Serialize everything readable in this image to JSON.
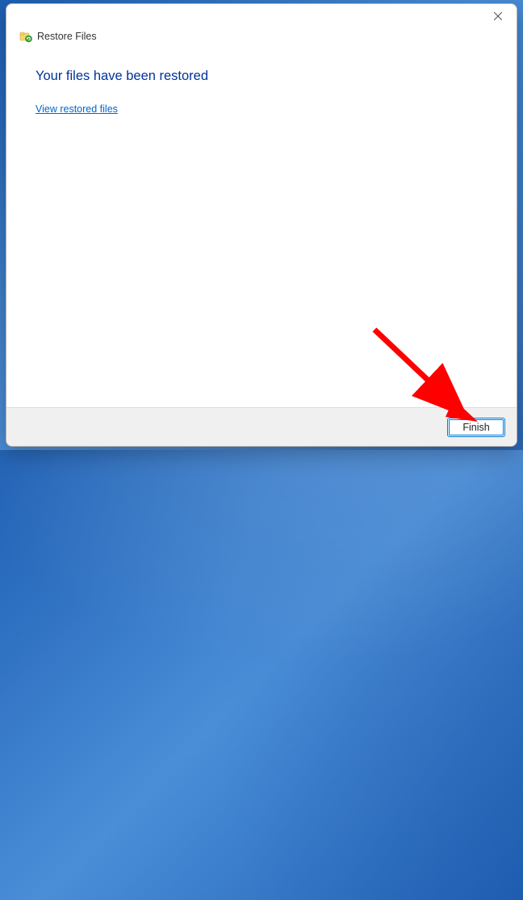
{
  "dialog": {
    "title": "Restore Files",
    "heading": "Your files have been restored",
    "link_label": "View restored files",
    "finish_label": "Finish"
  },
  "icons": {
    "close": "close-icon",
    "restore": "restore-files-icon"
  },
  "annotation": {
    "arrow_color": "#ff0000"
  }
}
